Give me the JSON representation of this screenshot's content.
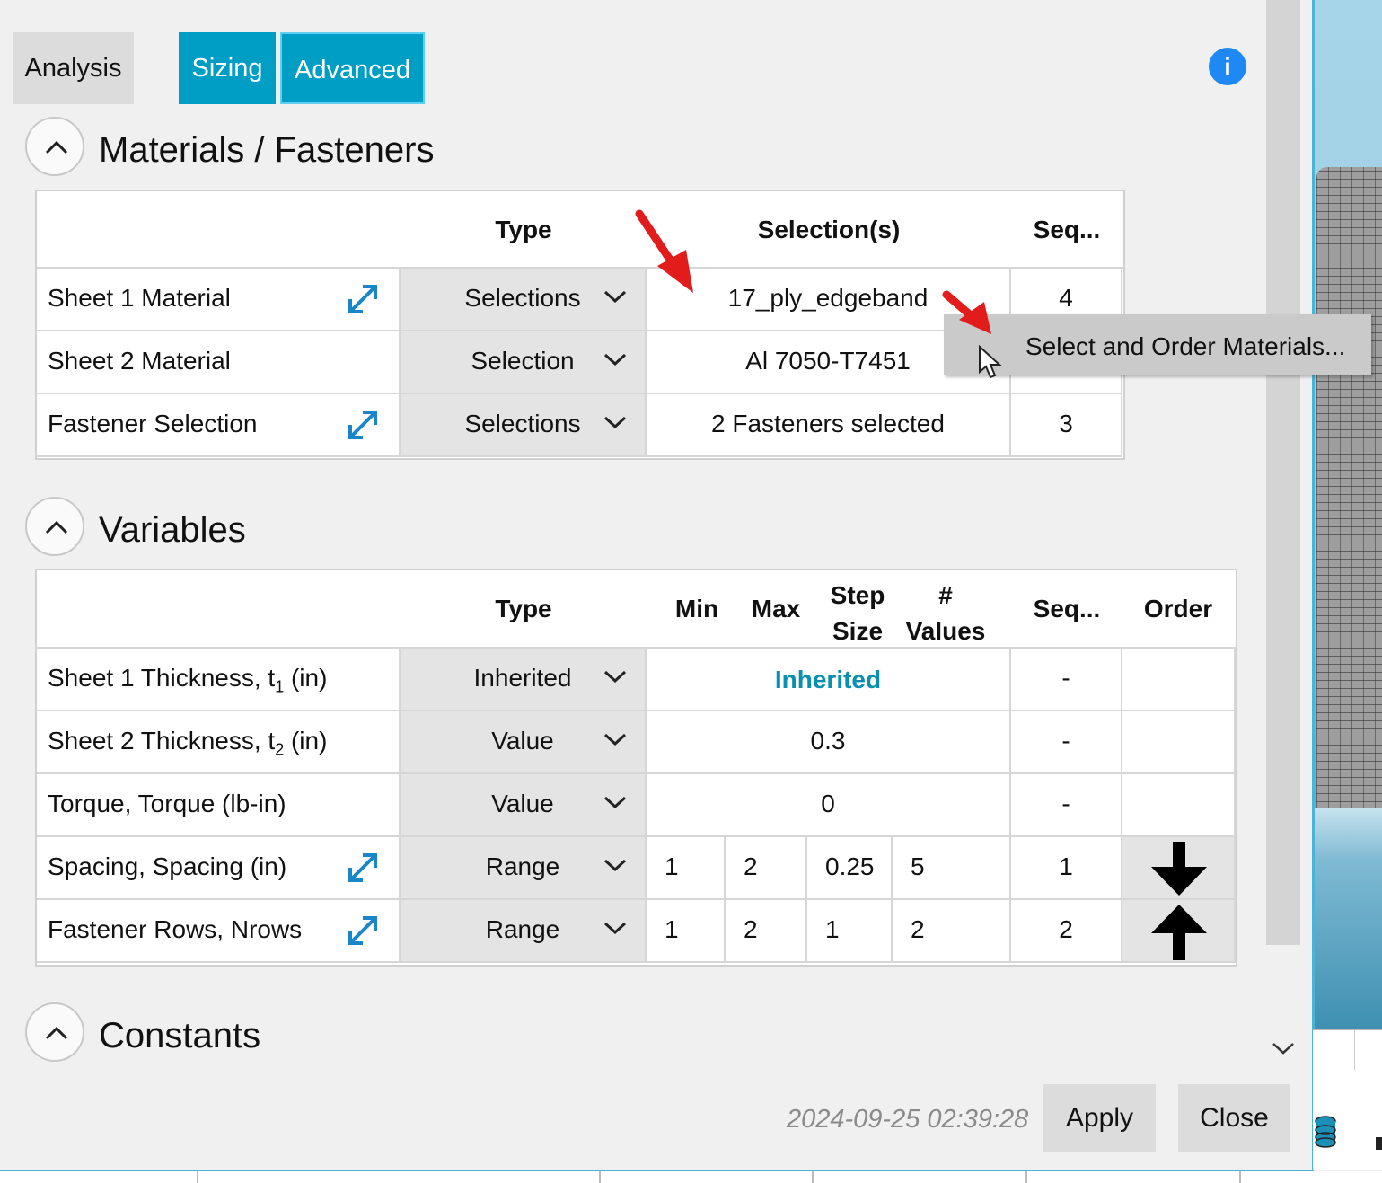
{
  "tabs": {
    "analysis": "Analysis",
    "sizing": "Sizing",
    "advanced": "Advanced"
  },
  "info_icon": "i",
  "materials": {
    "title": "Materials / Fasteners",
    "headers": {
      "type": "Type",
      "selections": "Selection(s)",
      "seq": "Seq..."
    },
    "rows": [
      {
        "label": "Sheet 1 Material",
        "type": "Selections",
        "selection": "17_ply_edgeband",
        "seq": "4"
      },
      {
        "label": "Sheet 2 Material",
        "type": "Selection",
        "selection": "Al 7050-T7451",
        "seq": ""
      },
      {
        "label": "Fastener Selection",
        "type": "Selections",
        "selection": "2 Fasteners selected",
        "seq": "3"
      }
    ]
  },
  "context_menu": {
    "item": "Select and Order Materials..."
  },
  "variables": {
    "title": "Variables",
    "headers": {
      "type": "Type",
      "min": "Min",
      "max": "Max",
      "step_1": "Step",
      "step_2": "Size",
      "values_1": "#",
      "values_2": "Values",
      "seq": "Seq...",
      "order": "Order"
    },
    "rows": [
      {
        "label_pre": "Sheet 1 Thickness, t",
        "label_sub": "1",
        "label_post": " (in)",
        "type": "Inherited",
        "value": "Inherited",
        "seq": "-"
      },
      {
        "label_pre": "Sheet 2 Thickness, t",
        "label_sub": "2",
        "label_post": " (in)",
        "type": "Value",
        "value": "0.3",
        "seq": "-"
      },
      {
        "label": "Torque, Torque (lb-in)",
        "type": "Value",
        "value": "0",
        "seq": "-"
      },
      {
        "label": "Spacing, Spacing (in)",
        "type": "Range",
        "min": "1",
        "max": "2",
        "step": "0.25",
        "count": "5",
        "seq": "1"
      },
      {
        "label": "Fastener Rows, Nrows",
        "type": "Range",
        "min": "1",
        "max": "2",
        "step": "1",
        "count": "2",
        "seq": "2"
      }
    ]
  },
  "constants": {
    "title": "Constants"
  },
  "footer": {
    "timestamp": "2024-09-25 02:39:28",
    "apply": "Apply",
    "close": "Close"
  },
  "icons": {
    "collapse": "chevron-up-icon",
    "dropdown": "chevron-down-icon",
    "expand": "diagonal-expand-icon",
    "info": "info-icon",
    "order_down": "arrow-down-icon",
    "order_up": "arrow-up-icon",
    "scroll_down": "chevron-down-icon",
    "database": "database-icon",
    "annotation": "red-arrow-icon",
    "pointer": "mouse-cursor-icon"
  },
  "colors": {
    "accent": "#009dc4",
    "inherited": "#0a8fae",
    "info": "#1e88f5",
    "annotation": "#e21b1b"
  }
}
